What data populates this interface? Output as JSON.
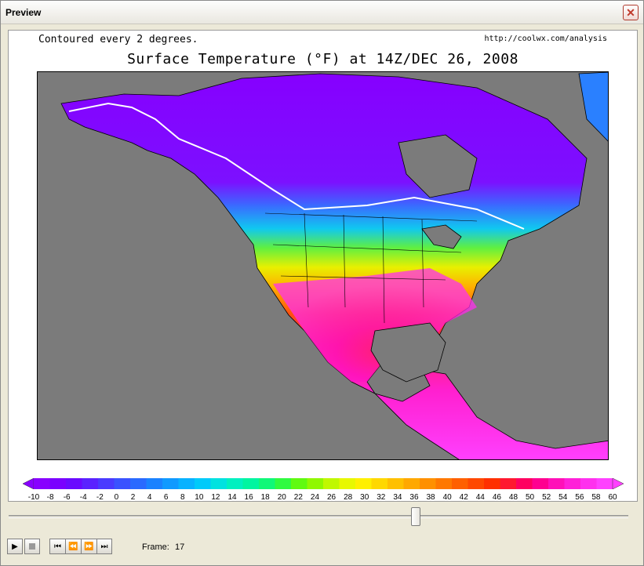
{
  "window": {
    "title": "Preview",
    "close_icon": "close-icon"
  },
  "map": {
    "note": "Contoured every 2 degrees.",
    "url": "http://coolwx.com/analysis",
    "title": "Surface Temperature (°F) at 14Z/DEC 26, 2008",
    "colorbar_labels": [
      "-10",
      "-8",
      "-6",
      "-4",
      "-2",
      "0",
      "2",
      "4",
      "6",
      "8",
      "10",
      "12",
      "14",
      "16",
      "18",
      "20",
      "22",
      "24",
      "26",
      "28",
      "30",
      "32",
      "34",
      "36",
      "38",
      "40",
      "42",
      "44",
      "46",
      "48",
      "50",
      "52",
      "54",
      "56",
      "58",
      "60"
    ],
    "colorbar_colors": [
      "#8800ff",
      "#7a00ff",
      "#6a0aff",
      "#5a22ff",
      "#4a3aff",
      "#3a52ff",
      "#2a6aff",
      "#1a82ff",
      "#109aff",
      "#08b2ff",
      "#00cafa",
      "#00e2e0",
      "#00f0c0",
      "#00f5a0",
      "#10f878",
      "#30fa40",
      "#60fa10",
      "#90f800",
      "#c0f800",
      "#e8f800",
      "#fff000",
      "#ffd800",
      "#ffc000",
      "#ffa800",
      "#ff9000",
      "#ff7800",
      "#ff6000",
      "#ff4800",
      "#ff3000",
      "#ff1830",
      "#ff0060",
      "#ff0090",
      "#ff10b8",
      "#ff20d8",
      "#ff30ee",
      "#ff40ff"
    ]
  },
  "playback": {
    "frame_label": "Frame:",
    "frame_value": "17",
    "slider_fraction": 0.66,
    "icons": [
      "play-icon",
      "stop-icon",
      "skip-to-start-icon",
      "step-back-icon",
      "step-forward-icon",
      "skip-to-end-icon"
    ]
  }
}
